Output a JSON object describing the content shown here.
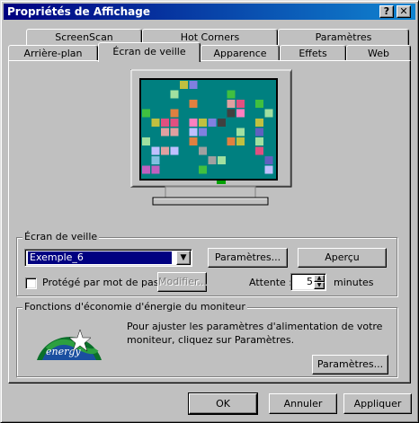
{
  "window": {
    "title": "Propriétés de Affichage",
    "help_label": "?",
    "close_label": "✕"
  },
  "tabs_row_back": [
    {
      "label": "ScreenScan"
    },
    {
      "label": "Hot Corners"
    },
    {
      "label": "Paramètres"
    }
  ],
  "tabs_row_front": [
    {
      "label": "Arrière-plan"
    },
    {
      "label": "Écran de veille"
    },
    {
      "label": "Apparence"
    },
    {
      "label": "Effets"
    },
    {
      "label": "Web"
    }
  ],
  "active_tab": "Écran de veille",
  "screensaver": {
    "group_label": "Écran de veille",
    "selected": "Exemple_6",
    "settings_button": "Paramètres...",
    "preview_button": "Aperçu",
    "password_checkbox_label": "Protégé par mot de passe",
    "password_checked": false,
    "modify_button": "Modifier...",
    "wait_label": "Attente :",
    "wait_value": "5",
    "wait_unit": "minutes"
  },
  "energy": {
    "group_label": "Fonctions d'économie d'énergie du moniteur",
    "description": "Pour ajuster les paramètres d'alimentation de votre moniteur, cliquez sur Paramètres.",
    "settings_button": "Paramètres...",
    "logo_text": "energy"
  },
  "footer": {
    "ok": "OK",
    "cancel": "Annuler",
    "apply": "Appliquer"
  },
  "colors": {
    "title_start": "#000080",
    "title_end": "#1084d0",
    "preview_bg": "#008080",
    "face": "#c0c0c0"
  }
}
